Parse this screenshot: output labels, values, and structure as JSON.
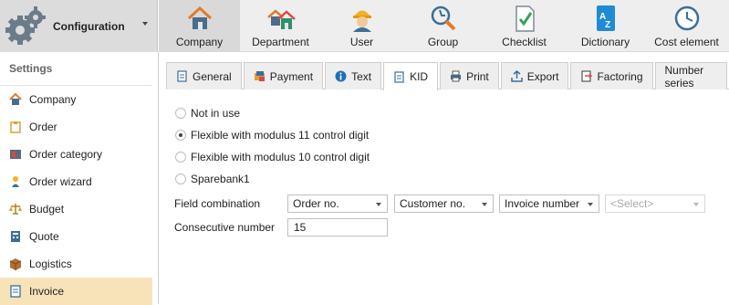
{
  "config": {
    "title": "Configuration"
  },
  "toolbar": {
    "items": [
      {
        "label": "Company",
        "icon": "house-icon"
      },
      {
        "label": "Department",
        "icon": "houses-icon"
      },
      {
        "label": "User",
        "icon": "worker-icon"
      },
      {
        "label": "Group",
        "icon": "group-tools-icon"
      },
      {
        "label": "Checklist",
        "icon": "checklist-icon"
      },
      {
        "label": "Dictionary",
        "icon": "dictionary-icon"
      },
      {
        "label": "Cost element",
        "icon": "clock-icon"
      }
    ]
  },
  "sidebar": {
    "heading": "Settings",
    "items": [
      {
        "label": "Company"
      },
      {
        "label": "Order"
      },
      {
        "label": "Order category"
      },
      {
        "label": "Order wizard"
      },
      {
        "label": "Budget"
      },
      {
        "label": "Quote"
      },
      {
        "label": "Logistics"
      },
      {
        "label": "Invoice"
      }
    ]
  },
  "tabs": [
    {
      "label": "General"
    },
    {
      "label": "Payment"
    },
    {
      "label": "Text"
    },
    {
      "label": "KID"
    },
    {
      "label": "Print"
    },
    {
      "label": "Export"
    },
    {
      "label": "Factoring"
    },
    {
      "label": "Number series"
    }
  ],
  "kid": {
    "options": [
      {
        "label": "Not in use",
        "selected": false
      },
      {
        "label": "Flexible with modulus 11 control digit",
        "selected": true
      },
      {
        "label": "Flexible with modulus 10 control digit",
        "selected": false
      },
      {
        "label": "Sparebank1",
        "selected": false
      }
    ],
    "field_combination_label": "Field combination",
    "field_combination": [
      "Order no.",
      "Customer no.",
      "Invoice number",
      "<Select>"
    ],
    "consecutive_label": "Consecutive number",
    "consecutive_value": "15"
  }
}
